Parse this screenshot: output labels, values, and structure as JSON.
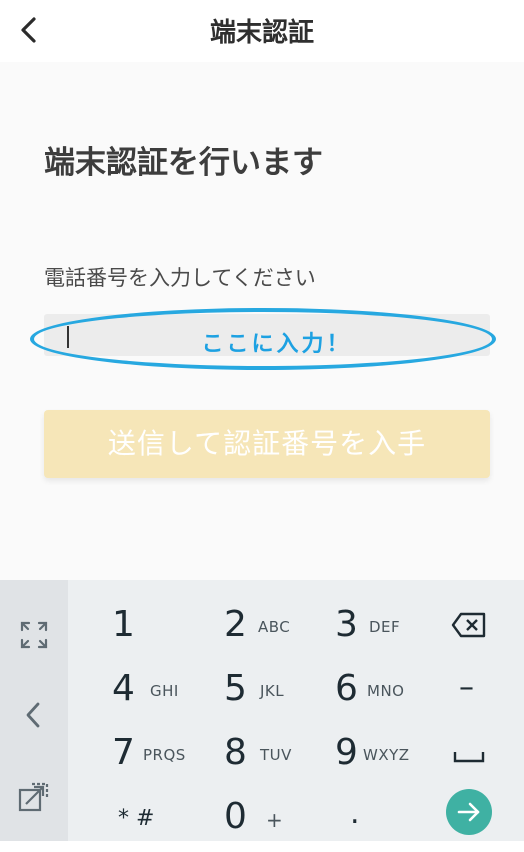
{
  "header": {
    "title": "端末認証",
    "back_icon": "chevron-left-icon"
  },
  "main": {
    "heading": "端末認証を行います",
    "phone_label": "電話番号を入力してください",
    "phone_value": "",
    "annotation": "ここに入力！",
    "submit_label": "送信して認証番号を入手"
  },
  "keyboard": {
    "keys": [
      {
        "digit": "1",
        "letters": ""
      },
      {
        "digit": "2",
        "letters": "ABC"
      },
      {
        "digit": "3",
        "letters": "DEF"
      },
      {
        "digit": "4",
        "letters": "GHI"
      },
      {
        "digit": "5",
        "letters": "JKL"
      },
      {
        "digit": "6",
        "letters": "MNO"
      },
      {
        "digit": "7",
        "letters": "PRQS"
      },
      {
        "digit": "8",
        "letters": "TUV"
      },
      {
        "digit": "9",
        "letters": "WXYZ"
      },
      {
        "digit": "* #",
        "letters": ""
      },
      {
        "digit": "0",
        "letters": "+"
      },
      {
        "digit": ".",
        "letters": ""
      }
    ],
    "dash": "–",
    "colors": {
      "enter": "#3fb1a3",
      "annotation": "#1da1e2"
    }
  }
}
